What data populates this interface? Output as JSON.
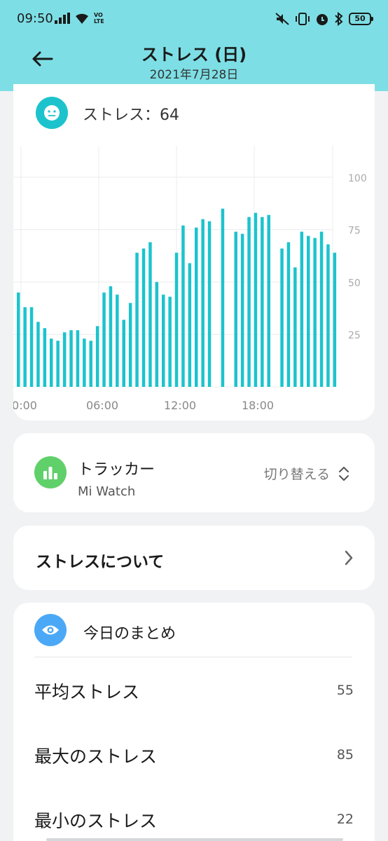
{
  "status_bar": {
    "time": "09:50",
    "battery": "50",
    "volte": "VO LTE"
  },
  "header": {
    "title": "ストレス (日)",
    "date": "2021年7月28日"
  },
  "stress_card": {
    "label": "ストレス：64"
  },
  "chart_data": {
    "type": "bar",
    "x_ticks": [
      "0:00",
      "06:00",
      "12:00",
      "18:00"
    ],
    "y_ticks": [
      "100",
      "75",
      "50",
      "25"
    ],
    "ylim": [
      0,
      115
    ],
    "grid": true,
    "bar_color": "#1cc3cd",
    "values": [
      45,
      38,
      38,
      31,
      28,
      23,
      22,
      26,
      27,
      27,
      23,
      22,
      29,
      45,
      48,
      44,
      32,
      40,
      64,
      66,
      69,
      50,
      44,
      43,
      64,
      77,
      59,
      76,
      80,
      79,
      null,
      85,
      null,
      74,
      73,
      81,
      83,
      81,
      82,
      null,
      66,
      69,
      57,
      74,
      72,
      71,
      74,
      68,
      64
    ]
  },
  "tracker": {
    "title": "トラッカー",
    "device": "Mi Watch",
    "switch_label": "切り替える"
  },
  "about": {
    "label": "ストレスについて"
  },
  "summary": {
    "title": "今日のまとめ",
    "rows": [
      {
        "label": "平均ストレス",
        "value": "55"
      },
      {
        "label": "最大のストレス",
        "value": "85"
      },
      {
        "label": "最小のストレス",
        "value": "22"
      }
    ]
  },
  "colors": {
    "header_bg": "#7ddfe5",
    "accent": "#1cc3cd",
    "tracker_icon": "#5fd06a",
    "eye_icon": "#4aa8f7"
  }
}
